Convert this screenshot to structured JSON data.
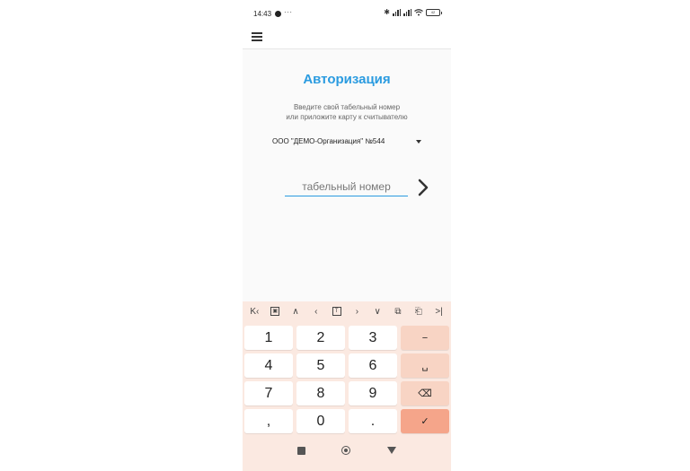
{
  "status_bar": {
    "time": "14:43",
    "more": "···",
    "bluetooth": "✱",
    "battery": "42"
  },
  "app_bar": {
    "menu_icon": "hamburger-menu-icon"
  },
  "auth": {
    "title": "Авторизация",
    "instruction_line1": "Введите свой табельный номер",
    "instruction_line2": "или приложите карту к считывателю",
    "organization": "ООО \"ДЕМО-Организация\" №544",
    "input_placeholder": "табельный номер",
    "input_value": "",
    "next_icon": "chevron-right-icon"
  },
  "keyboard": {
    "toolbar": [
      "K‹",
      "▣",
      "∧",
      "‹",
      "T",
      "›",
      "∨",
      "⧉",
      "⎗",
      ">|"
    ],
    "rows": [
      [
        "1",
        "2",
        "3",
        "−"
      ],
      [
        "4",
        "5",
        "6",
        "␣"
      ],
      [
        "7",
        "8",
        "9",
        "⌫"
      ],
      [
        ",",
        "0",
        ".",
        "✓"
      ]
    ]
  },
  "colors": {
    "accent": "#2a9be0",
    "keyboard_bg": "#fbe9e1",
    "function_key": "#f8d4c4",
    "enter_key": "#f5a58a"
  }
}
